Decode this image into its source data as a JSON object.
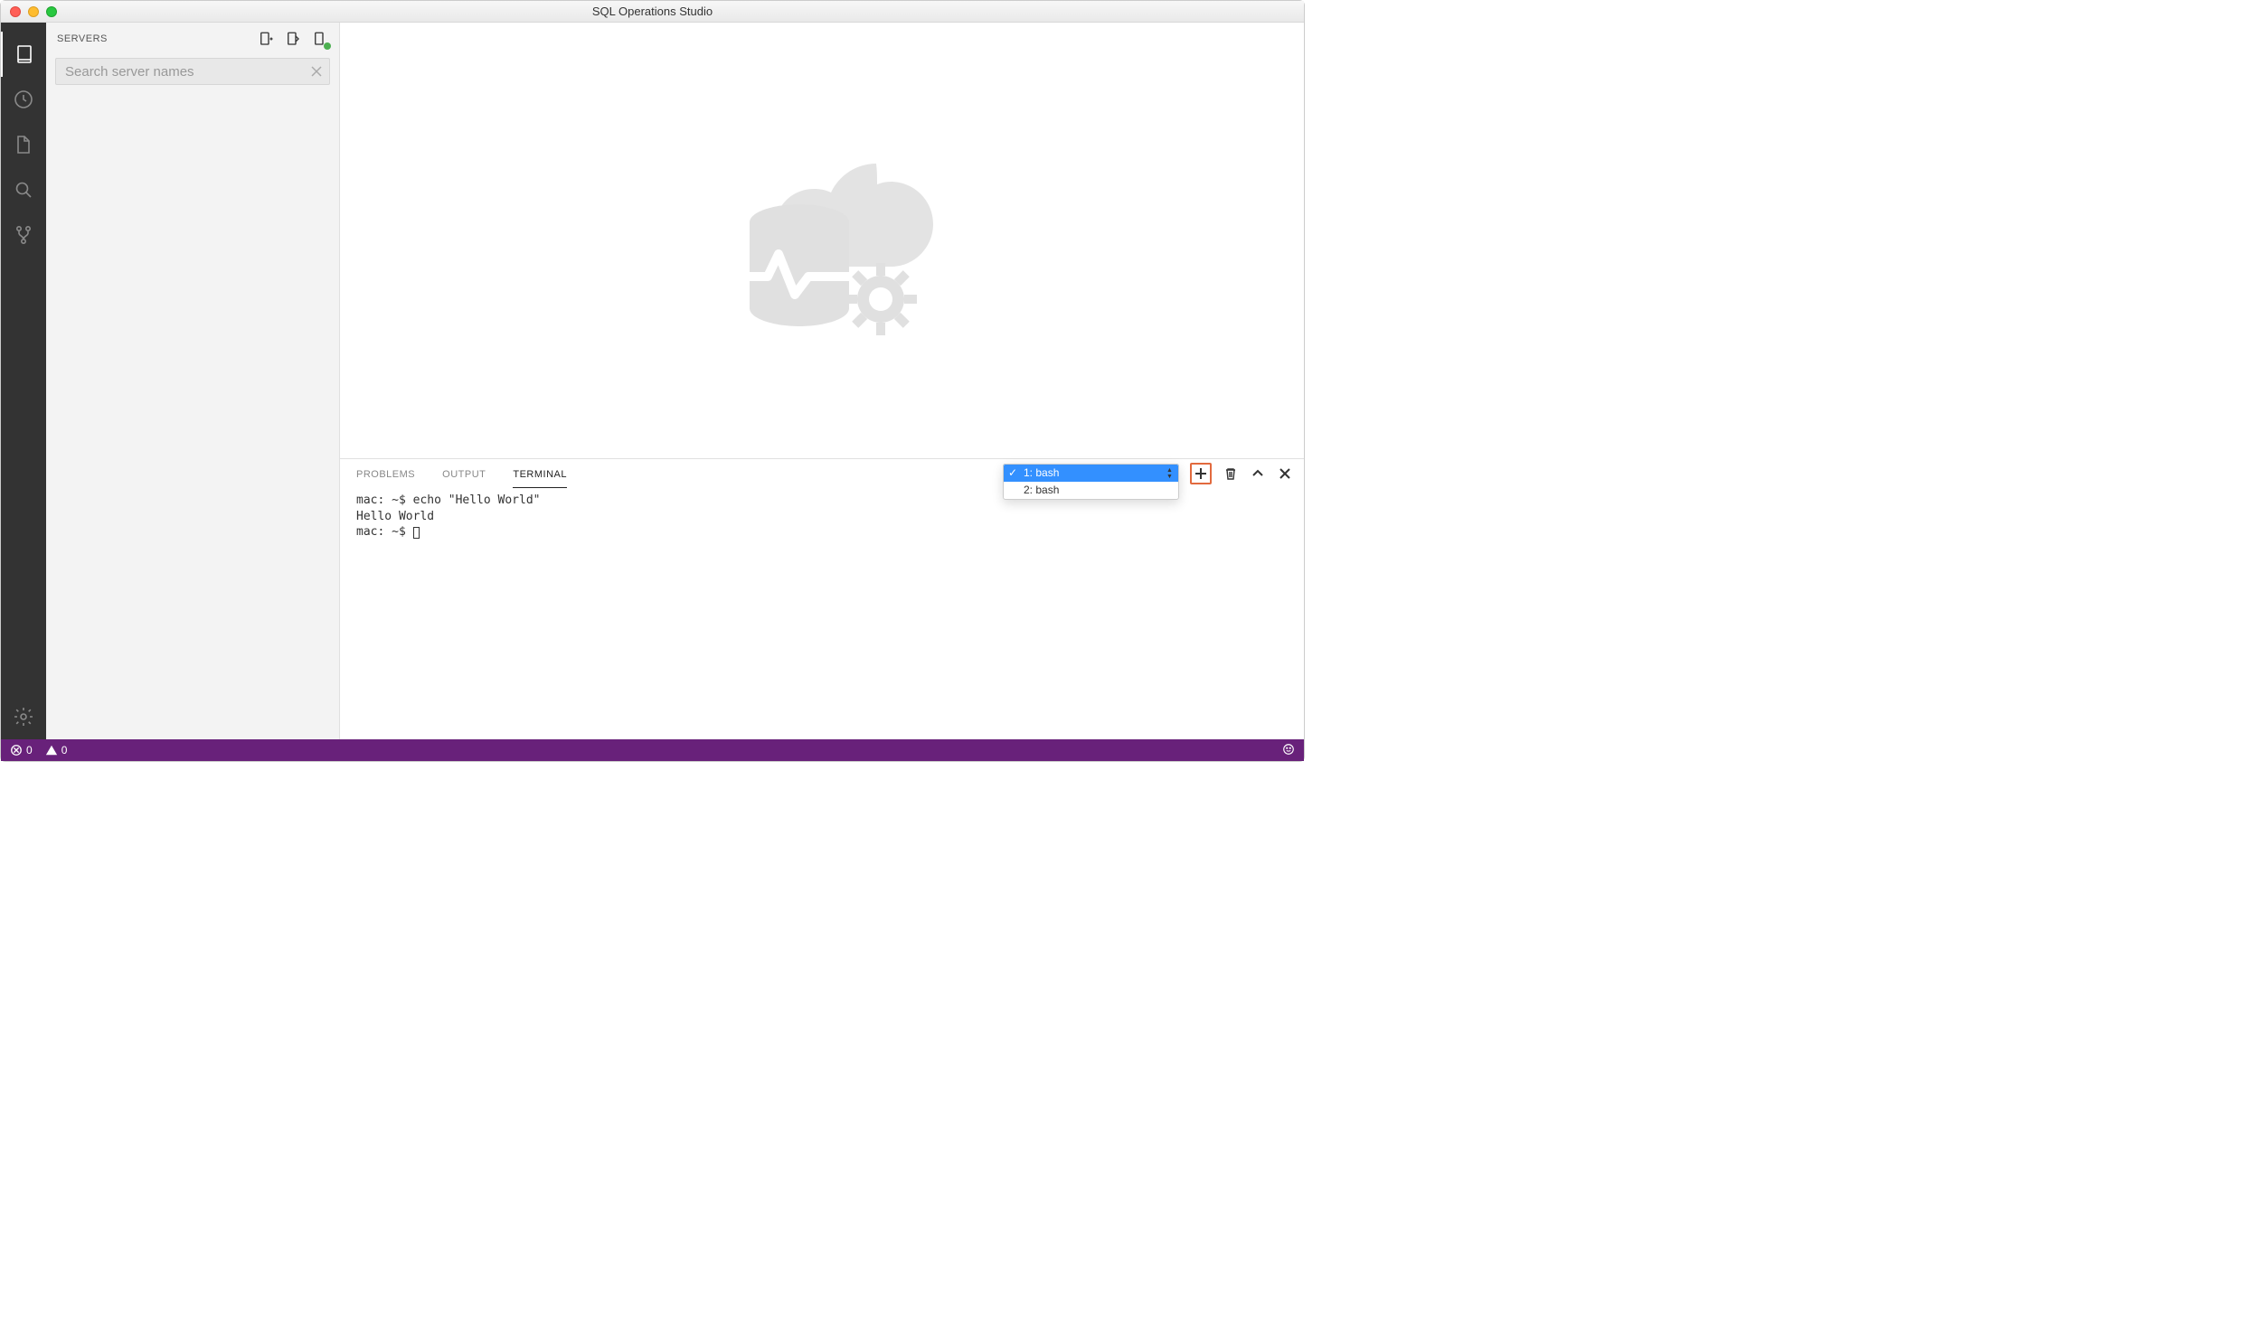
{
  "titlebar": {
    "title": "SQL Operations Studio"
  },
  "sidebar": {
    "title": "SERVERS",
    "search_placeholder": "Search server names"
  },
  "panel": {
    "tabs": {
      "problems": "PROBLEMS",
      "output": "OUTPUT",
      "terminal": "TERMINAL"
    },
    "terminal_select": {
      "options": [
        {
          "label": "1: bash",
          "selected": true
        },
        {
          "label": "2: bash",
          "selected": false
        }
      ]
    },
    "terminal_lines": {
      "l1": "mac: ~$ echo \"Hello World\"",
      "l2": "Hello World",
      "l3": "mac: ~$ "
    }
  },
  "statusbar": {
    "errors": "0",
    "warnings": "0"
  }
}
